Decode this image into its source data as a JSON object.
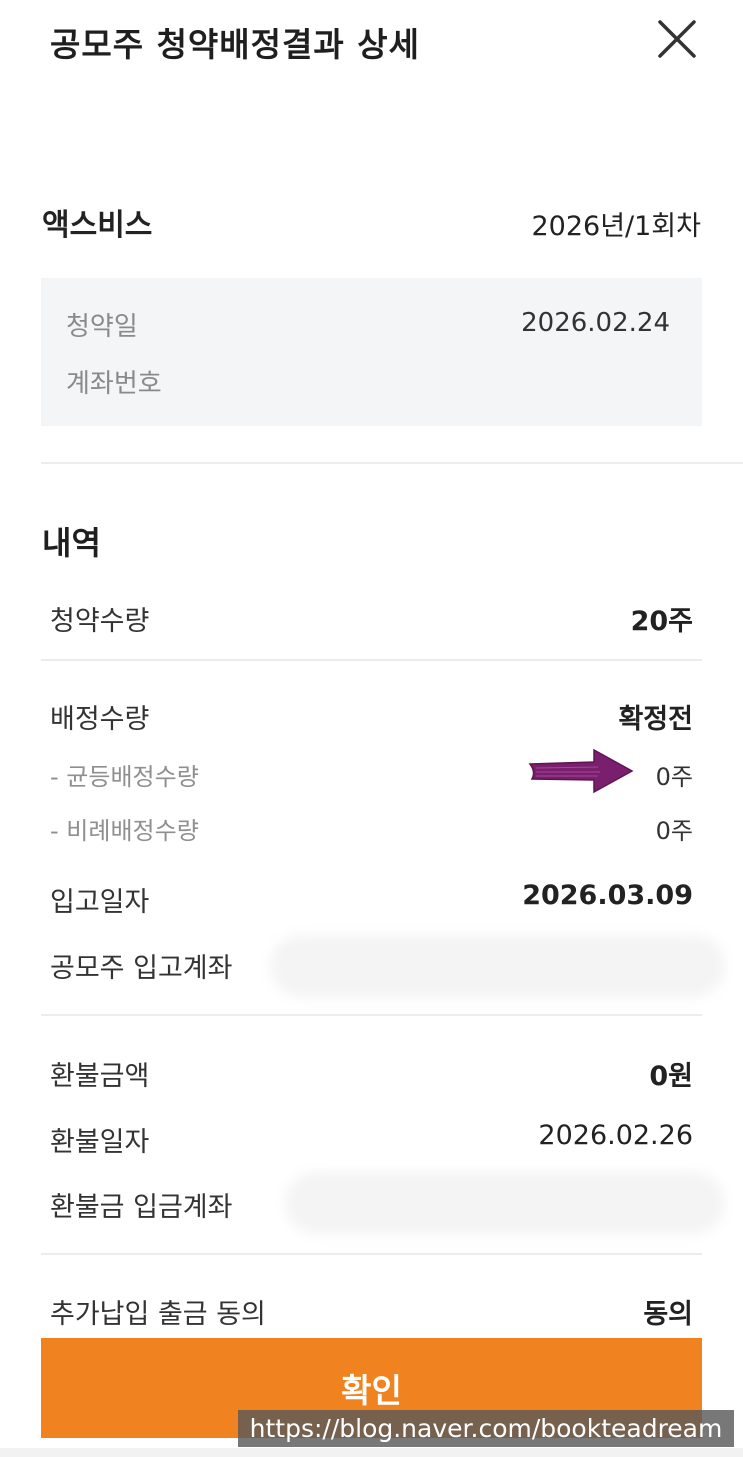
{
  "header": {
    "title": "공모주 청약배정결과 상세",
    "close_icon": "close-icon"
  },
  "summary": {
    "stock_name": "액스비스",
    "round": "2026년/1회차"
  },
  "info_box": {
    "subscription_date_label": "청약일",
    "subscription_date_value": "2026.02.24",
    "account_label": "계좌번호"
  },
  "details": {
    "section_title": "내역",
    "subscription_qty_label": "청약수량",
    "subscription_qty_value": "20주",
    "allotment_qty_label": "배정수량",
    "allotment_qty_value": "확정전",
    "equal_allotment_label": "- 균등배정수량",
    "equal_allotment_value": "0주",
    "proportional_allotment_label": "- 비례배정수량",
    "proportional_allotment_value": "0주",
    "deposit_date_label": "입고일자",
    "deposit_date_value": "2026.03.09",
    "deposit_account_label": "공모주 입고계좌",
    "refund_amount_label": "환불금액",
    "refund_amount_value": "0원",
    "refund_date_label": "환불일자",
    "refund_date_value": "2026.02.26",
    "refund_account_label": "환불금 입금계좌",
    "additional_payment_label": "추가납입 출금 동의",
    "additional_payment_value": "동의"
  },
  "confirm_button": {
    "label": "확인"
  },
  "watermark": {
    "text": "https://blog.naver.com/bookteadream"
  },
  "colors": {
    "accent": "#f0821f",
    "arrow": "#7a1f6e",
    "box_bg": "#f4f5f7"
  }
}
